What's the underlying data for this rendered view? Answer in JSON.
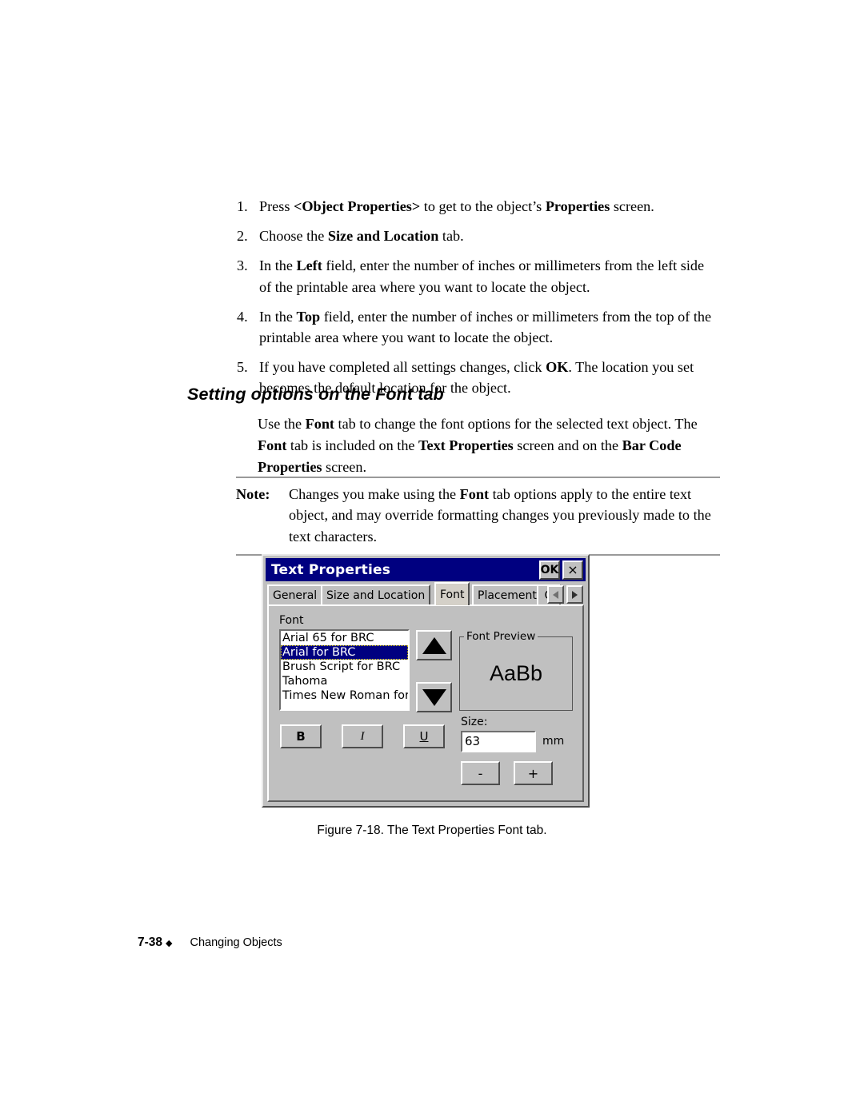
{
  "steps": [
    {
      "num": "1.",
      "parts": [
        {
          "t": "Press ",
          "b": false
        },
        {
          "t": "<Object Properties>",
          "b": true
        },
        {
          "t": " to get to the object’s ",
          "b": false
        },
        {
          "t": "Properties",
          "b": true
        },
        {
          "t": " screen.",
          "b": false
        }
      ]
    },
    {
      "num": "2.",
      "parts": [
        {
          "t": "Choose the ",
          "b": false
        },
        {
          "t": "Size and Location",
          "b": true
        },
        {
          "t": " tab.",
          "b": false
        }
      ]
    },
    {
      "num": "3.",
      "parts": [
        {
          "t": "In the ",
          "b": false
        },
        {
          "t": "Left",
          "b": true
        },
        {
          "t": " field, enter the number of inches or millimeters from the left side of the printable area where you want to locate the object.",
          "b": false
        }
      ]
    },
    {
      "num": "4.",
      "parts": [
        {
          "t": "In the ",
          "b": false
        },
        {
          "t": "Top",
          "b": true
        },
        {
          "t": " field, enter the number of inches or millimeters from the top of the printable area where you want to locate the object.",
          "b": false
        }
      ]
    },
    {
      "num": "5.",
      "parts": [
        {
          "t": "If you have completed all settings changes, click ",
          "b": false
        },
        {
          "t": "OK",
          "b": true
        },
        {
          "t": ". The location you set becomes the default location for the object.",
          "b": false
        }
      ]
    }
  ],
  "section": {
    "heading": "Setting options on the Font tab",
    "paragraph": [
      {
        "t": "Use the ",
        "b": false
      },
      {
        "t": "Font",
        "b": true
      },
      {
        "t": " tab to change the font options for the selected text object. The ",
        "b": false
      },
      {
        "t": "Font",
        "b": true
      },
      {
        "t": " tab is included on the ",
        "b": false
      },
      {
        "t": "Text Properties",
        "b": true
      },
      {
        "t": " screen and on the ",
        "b": false
      },
      {
        "t": "Bar Code Properties",
        "b": true
      },
      {
        "t": " screen.",
        "b": false
      }
    ]
  },
  "note": {
    "label": "Note:",
    "parts": [
      {
        "t": "Changes you make using the ",
        "b": false
      },
      {
        "t": "Font",
        "b": true
      },
      {
        "t": " tab options apply to the entire text object, and may override formatting changes you previously made to the text characters.",
        "b": false
      }
    ]
  },
  "dialog": {
    "title": "Text Properties",
    "ok_label": "OK",
    "close_label": "×",
    "tabs": [
      {
        "label": "General",
        "active": false
      },
      {
        "label": "Size and Location",
        "active": false
      },
      {
        "label": "Font",
        "active": true
      },
      {
        "label": "Placement",
        "active": false
      },
      {
        "label": "O",
        "active": false
      }
    ],
    "scroll_left": "◄",
    "scroll_right": "►",
    "font_group_label": "Font",
    "font_list": [
      {
        "label": "Arial 65 for BRC",
        "selected": false
      },
      {
        "label": "Arial for BRC",
        "selected": true
      },
      {
        "label": "Brush Script for BRC",
        "selected": false
      },
      {
        "label": "Tahoma",
        "selected": false
      },
      {
        "label": "Times New Roman for BRC",
        "selected": false
      }
    ],
    "scroll_up_icon": "▲",
    "scroll_down_icon": "▼",
    "preview_legend": "Font Preview",
    "preview_sample": "AaBb",
    "bold_label": "B",
    "italic_label": "I",
    "underline_label": "U",
    "size_label": "Size:",
    "size_value": "63",
    "size_unit": "mm",
    "decrease_label": "-",
    "increase_label": "+",
    "colors": {
      "titlebar": "#000080",
      "face": "#c0c0c0",
      "selection": "#000080",
      "focus_outline": "#d8c800"
    }
  },
  "figure_caption": "Figure 7-18. The Text Properties Font tab.",
  "footer": {
    "page": "7-38",
    "diamond": "◆",
    "chapter": "Changing Objects"
  }
}
